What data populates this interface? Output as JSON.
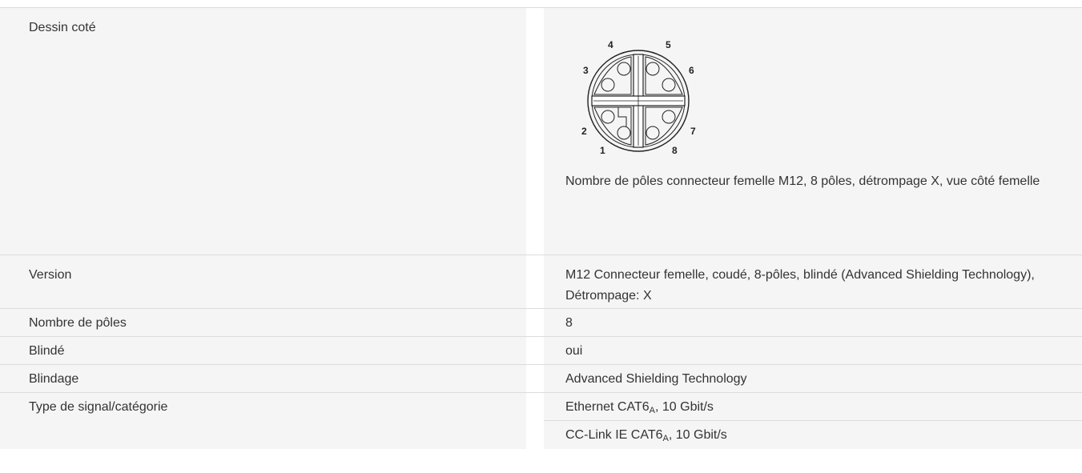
{
  "rows": {
    "drawing": {
      "label": "Dessin coté",
      "caption": "Nombre de pôles connecteur femelle M12, 8 pôles, détrompage X, vue côté femelle",
      "pins": [
        "1",
        "2",
        "3",
        "4",
        "5",
        "6",
        "7",
        "8"
      ]
    },
    "version": {
      "label": "Version",
      "value": "M12 Connecteur femelle, coudé, 8-pôles, blindé (Advanced Shielding Technology), Détrompage: X"
    },
    "poles": {
      "label": "Nombre de pôles",
      "value": "8"
    },
    "shielded": {
      "label": "Blindé",
      "value": "oui"
    },
    "shielding": {
      "label": "Blindage",
      "value": "Advanced Shielding Technology"
    },
    "signal": {
      "label": "Type de signal/catégorie",
      "items": [
        {
          "prefix": "Ethernet CAT6",
          "sub": "A",
          "suffix": ", 10 Gbit/s"
        },
        {
          "prefix": "CC-Link IE CAT6",
          "sub": "A",
          "suffix": ", 10 Gbit/s"
        }
      ]
    }
  }
}
